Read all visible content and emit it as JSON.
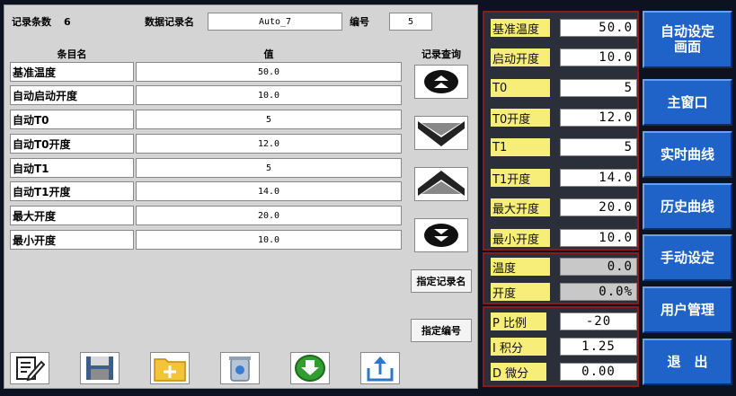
{
  "header": {
    "record_count_label": "记录条数",
    "record_count_value": "6",
    "record_name_label": "数据记录名",
    "record_name_value": "Auto_7",
    "number_label": "编号",
    "number_value": "5"
  },
  "table": {
    "col_name_header": "条目名",
    "col_value_header": "值",
    "query_header": "记录查询",
    "rows": [
      {
        "name": "基准温度",
        "value": "50.0"
      },
      {
        "name": "自动启动开度",
        "value": "10.0"
      },
      {
        "name": "自动T0",
        "value": "5"
      },
      {
        "name": "自动T0开度",
        "value": "12.0"
      },
      {
        "name": "自动T1",
        "value": "5"
      },
      {
        "name": "自动T1开度",
        "value": "14.0"
      },
      {
        "name": "最大开度",
        "value": "20.0"
      },
      {
        "name": "最小开度",
        "value": "10.0"
      }
    ]
  },
  "buttons": {
    "specify_record_name": "指定记录名",
    "specify_number": "指定编号"
  },
  "params": [
    {
      "label": "基准温度",
      "value": "50.0"
    },
    {
      "label": "启动开度",
      "value": "10.0"
    },
    {
      "label": "T0",
      "value": "5"
    },
    {
      "label": "T0开度",
      "value": "12.0"
    },
    {
      "label": "T1",
      "value": "5"
    },
    {
      "label": "T1开度",
      "value": "14.0"
    },
    {
      "label": "最大开度",
      "value": "20.0"
    },
    {
      "label": "最小开度",
      "value": "10.0"
    }
  ],
  "status": [
    {
      "label": "温度",
      "value": "0.0"
    },
    {
      "label": "开度",
      "value": "0.0%"
    }
  ],
  "pid": [
    {
      "label": "P 比例",
      "value": "-20"
    },
    {
      "label": "I 积分",
      "value": "1.25"
    },
    {
      "label": "D 微分",
      "value": "0.00"
    }
  ],
  "nav": {
    "auto_setting": "自动设定\n画面",
    "main_window": "主窗口",
    "realtime_curve": "实时曲线",
    "history_curve": "历史曲线",
    "manual_setting": "手动设定",
    "user_management": "用户管理",
    "exit": "退　出"
  },
  "colors": {
    "nav_blue": "#1f63c8",
    "param_label_yellow": "#f6ee79",
    "panel_border_red": "#8b1a1a"
  },
  "icons": [
    "edit-icon",
    "save-disk-icon",
    "new-folder-icon",
    "delete-trash-icon",
    "download-icon",
    "upload-icon",
    "first-record-icon",
    "next-record-icon",
    "previous-record-icon",
    "last-record-icon"
  ]
}
